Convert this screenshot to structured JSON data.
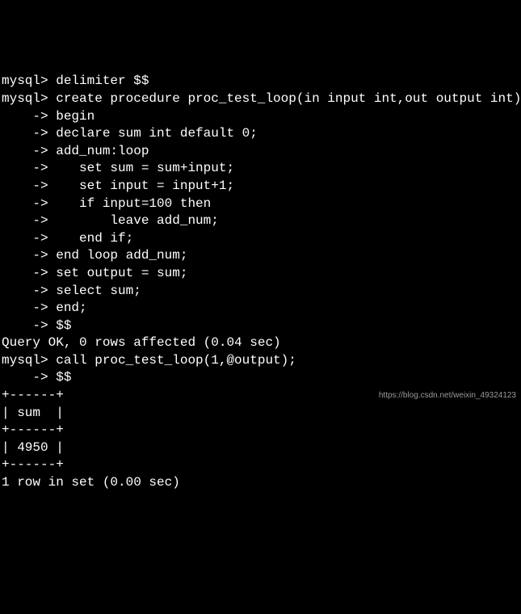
{
  "terminal": {
    "lines": [
      "mysql> delimiter $$",
      "mysql> create procedure proc_test_loop(in input int,out output int)",
      "    -> begin",
      "    -> declare sum int default 0;",
      "    -> add_num:loop",
      "    ->    set sum = sum+input;",
      "    ->    set input = input+1;",
      "    ->    if input=100 then",
      "    ->        leave add_num;",
      "    ->    end if;",
      "    -> end loop add_num;",
      "    -> set output = sum;",
      "    -> select sum;",
      "    -> end;",
      "    -> $$",
      "Query OK, 0 rows affected (0.04 sec)",
      "",
      "mysql> call proc_test_loop(1,@output);",
      "    -> $$",
      "+------+",
      "| sum  |",
      "+------+",
      "| 4950 |",
      "+------+",
      "1 row in set (0.00 sec)"
    ]
  },
  "watermark": "https://blog.csdn.net/weixin_49324123"
}
